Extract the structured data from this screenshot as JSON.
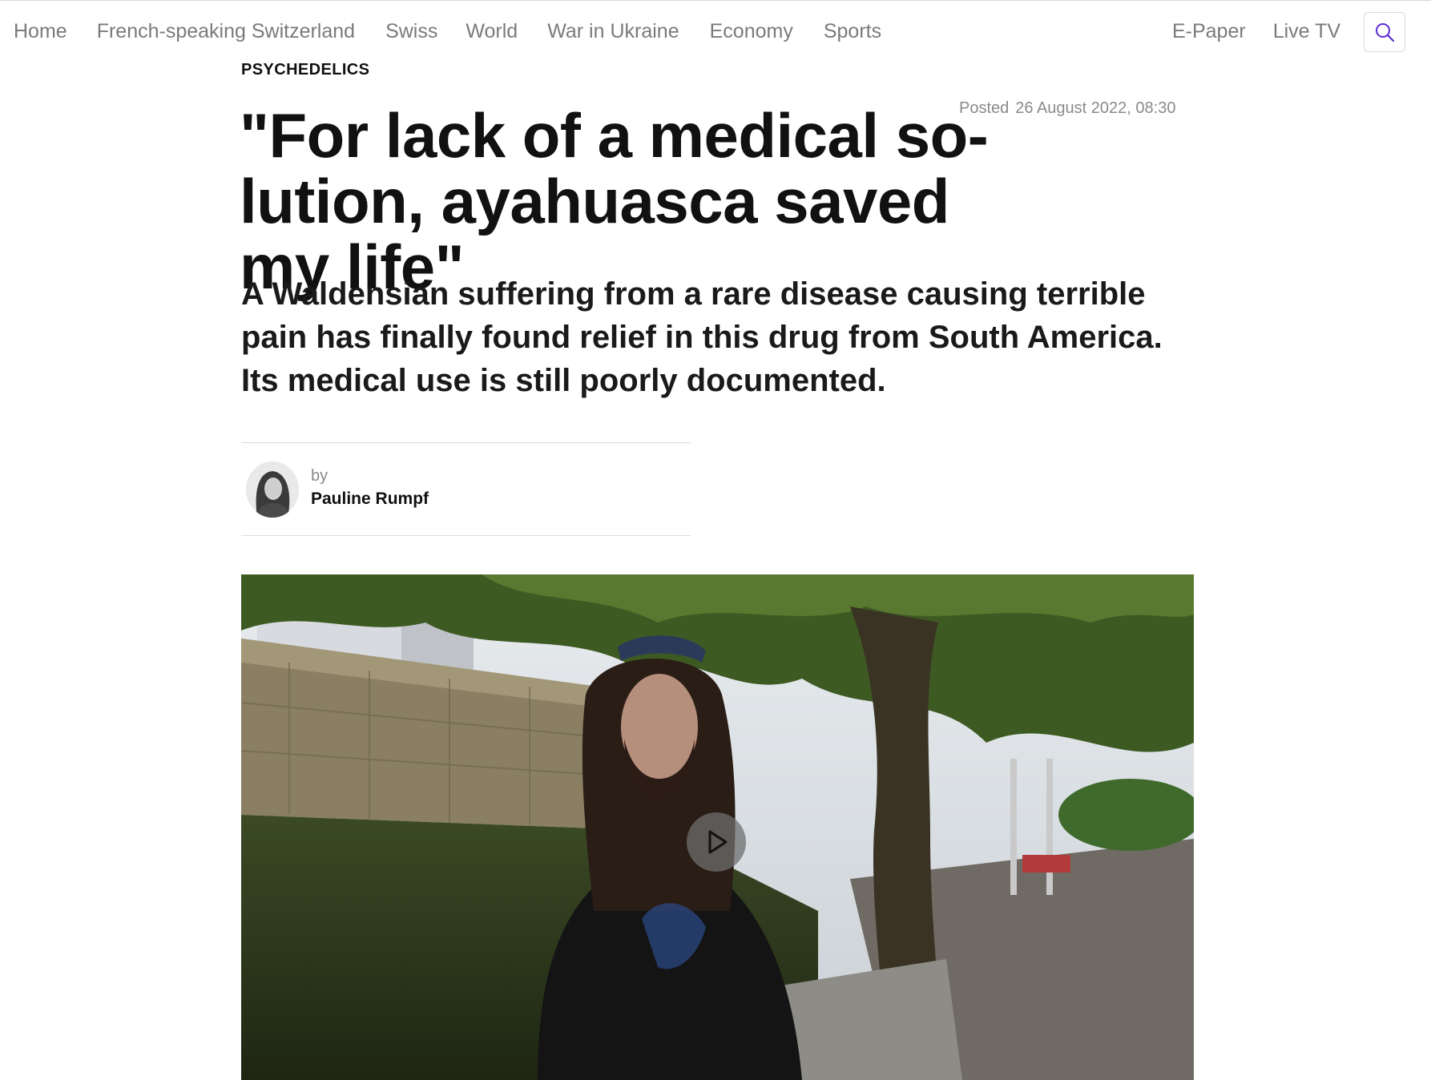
{
  "nav": {
    "left": [
      {
        "label": "Home",
        "name": "nav-home"
      },
      {
        "label": "French-speaking Switzerland",
        "name": "nav-french-speaking-switzerland"
      },
      {
        "label": "Swiss",
        "name": "nav-swiss"
      },
      {
        "label": "World",
        "name": "nav-world"
      },
      {
        "label": "War in Ukraine",
        "name": "nav-war-in-ukraine"
      },
      {
        "label": "Economy",
        "name": "nav-economy"
      },
      {
        "label": "Sports",
        "name": "nav-sports"
      }
    ],
    "right": [
      {
        "label": "E-Paper",
        "name": "nav-e-paper"
      },
      {
        "label": "Live TV",
        "name": "nav-live-tv"
      }
    ],
    "search_icon": "search-icon"
  },
  "article": {
    "kicker": "PSYCHEDELICS",
    "posted_label": "Posted",
    "posted_date": "26 August 2022, 08:30",
    "headline_line1": "\"For lack of a medical so-",
    "headline_line2": "lution, ayahuasca saved my life\"",
    "lead_line1": "A Waldensian suffering from a rare disease causing terrible",
    "lead_line2": "pain has finally found relief in this drug from South America.",
    "lead_line3": "Its medical use is still poorly documented.",
    "byline_prefix": "by",
    "author": "Pauline Rumpf"
  },
  "media": {
    "play_icon": "play-icon"
  },
  "colors": {
    "nav_text": "#7a7a7a",
    "search_icon": "#5b2bd6",
    "headline": "#111111"
  }
}
